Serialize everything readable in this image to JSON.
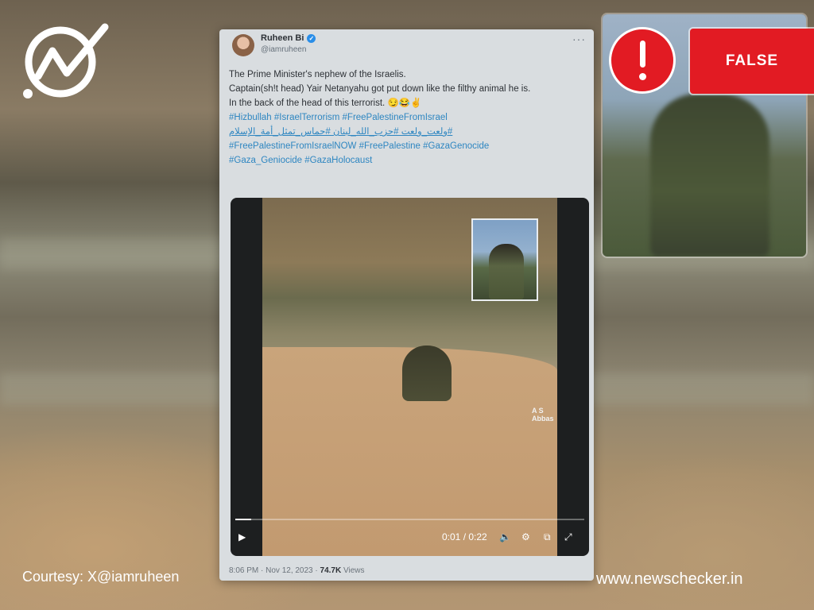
{
  "verdict": {
    "label": "FALSE",
    "color": "#e21b23"
  },
  "tweet": {
    "user": {
      "name": "Ruheen Bi",
      "handle": "@iamruheen"
    },
    "more_icon": "more-options-icon",
    "lines": [
      "The Prime Minister's nephew of the Israelis.",
      "Captain(sh!t head) Yair Netanyahu got put down like the filthy animal he is.",
      "In the back of the head of this terrorist. 😏😂✌️"
    ],
    "hashtags_line1": "#Hizbullah #IsraelTerrorism #FreePalestineFromIsrael",
    "hashtags_arabic": "#ولعت_ولعت #حزب_الله_لبنان #حماس_تمثل_أمة_الإسلام",
    "hashtags_line3": "#FreePalestineFromIsraelNOW #FreePalestine #GazaGenocide",
    "hashtags_line4": "#Gaza_Geniocide #GazaHolocaust",
    "video": {
      "watermark": "A S Abbas",
      "current_time": "0:01",
      "duration": "0:22",
      "progress": 0.045
    },
    "meta": {
      "time": "8:06 PM · Nov 12, 2023 · ",
      "views_count": "74.7K",
      "views_label": " Views"
    }
  },
  "footer": {
    "credit": "Courtesy: X@iamruheen",
    "site": "www.newschecker.in"
  }
}
